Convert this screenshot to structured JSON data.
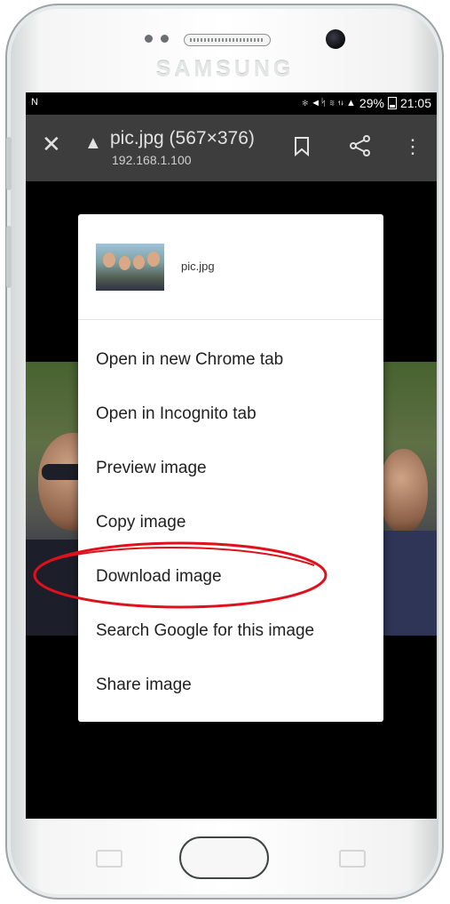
{
  "device": {
    "brand": "SAMSUNG"
  },
  "status_bar": {
    "left_icon": "N",
    "icons": "✻ ◄ᛋ ≋ ⇅ ▲",
    "battery": "29%",
    "time": "21:05"
  },
  "toolbar": {
    "title": "pic.jpg (567×376)",
    "host": "192.168.1.100",
    "close_icon": "close-icon",
    "warning_icon": "warning-icon"
  },
  "context_menu": {
    "file_name": "pic.jpg",
    "items": [
      "Open in new Chrome tab",
      "Open in Incognito tab",
      "Preview image",
      "Copy image",
      "Download image",
      "Search Google for this image",
      "Share image"
    ]
  },
  "colors": {
    "toolbar": "#3d3d3d",
    "highlight_oval": "#e0101c"
  }
}
